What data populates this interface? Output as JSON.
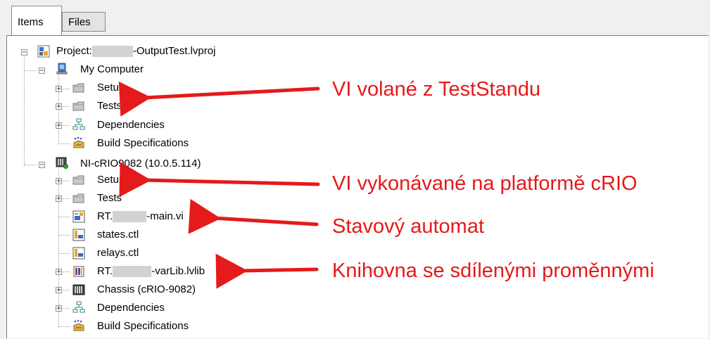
{
  "tabs": [
    {
      "label": "Items",
      "active": true
    },
    {
      "label": "Files",
      "active": false
    }
  ],
  "tree": {
    "project": {
      "prefix": "Project:",
      "suffix": "-OutputTest.lvproj",
      "icon": "project-icon"
    },
    "my_computer": {
      "label": "My Computer",
      "icon": "computer-icon",
      "children": [
        {
          "label": "Setup",
          "icon": "folder-icon"
        },
        {
          "label": "Tests",
          "icon": "folder-icon"
        },
        {
          "label": "Dependencies",
          "icon": "dependencies-icon"
        },
        {
          "label": "Build Specifications",
          "icon": "build-specifications-icon"
        }
      ]
    },
    "target": {
      "label": "NI-cRIO9082 (10.0.5.114)",
      "icon": "crio-target-icon",
      "children": [
        {
          "label": "Setup",
          "icon": "folder-icon"
        },
        {
          "label": "Tests",
          "icon": "folder-icon"
        },
        {
          "prefix": "RT.",
          "suffix": "-main.vi",
          "icon": "vi-icon"
        },
        {
          "label": "states.ctl",
          "icon": "control-icon"
        },
        {
          "label": "relays.ctl",
          "icon": "control-icon"
        },
        {
          "prefix": "RT.",
          "suffix": "-varLib.lvlib",
          "icon": "library-icon"
        },
        {
          "label": "Chassis (cRIO-9082)",
          "icon": "chassis-icon"
        },
        {
          "label": "Dependencies",
          "icon": "dependencies-icon"
        },
        {
          "label": "Build Specifications",
          "icon": "build-specifications-icon"
        }
      ]
    }
  },
  "annotations": [
    {
      "text": "VI volané z TestStandu"
    },
    {
      "text": "VI vykonávané na platformě cRIO"
    },
    {
      "text": "Stavový automat"
    },
    {
      "text": "Knihovna se sdílenými proměnnými"
    }
  ],
  "colors": {
    "annotation": "#e51a1a",
    "background": "#f0f0f0",
    "tree_background": "#ffffff"
  }
}
